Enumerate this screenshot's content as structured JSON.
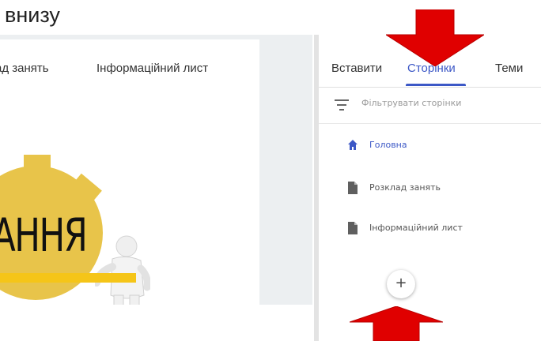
{
  "caption": "внизу",
  "site_nav": {
    "items": [
      "ад занять",
      "Інформаційний лист"
    ]
  },
  "hero": {
    "text": "АННЯ"
  },
  "panel": {
    "tabs": [
      "Вставити",
      "Сторінки",
      "Теми"
    ],
    "active_tab": "Сторінки",
    "filter_placeholder": "Фільтрувати сторінки",
    "pages": [
      {
        "label": "Головна",
        "icon": "home-icon",
        "active": true
      },
      {
        "label": "Розклад занять",
        "icon": "document-icon",
        "active": false
      },
      {
        "label": "Інформаційний лист",
        "icon": "document-icon",
        "active": false
      }
    ],
    "add_button": "+"
  },
  "colors": {
    "accent": "#3c58c6",
    "arrow": "#e00000",
    "hero_bar": "#f5c518",
    "gear": "#e8c44a"
  }
}
